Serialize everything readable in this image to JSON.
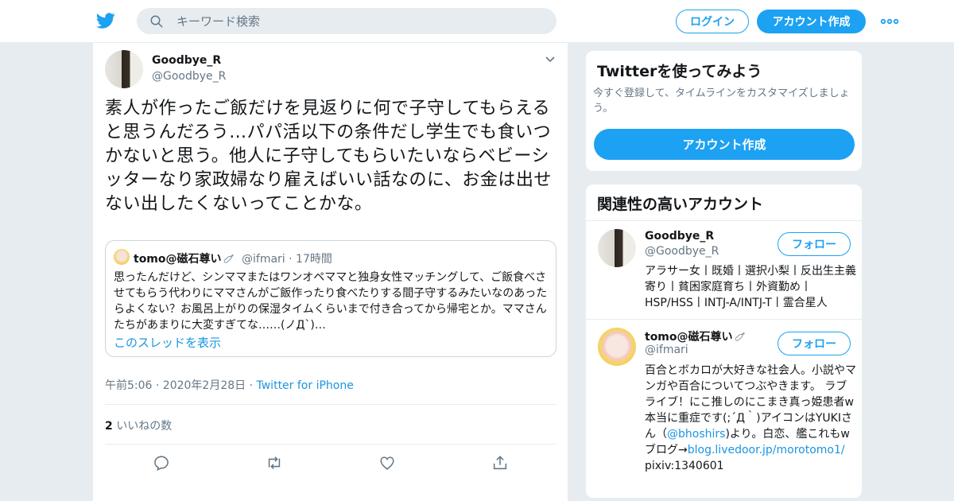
{
  "header": {
    "search_placeholder": "キーワード検索",
    "login_label": "ログイン",
    "signup_label": "アカウント作成"
  },
  "tweet": {
    "author_name": "Goodbye_R",
    "author_handle": "@Goodbye_R",
    "text": "素人が作ったご飯だけを見返りに何で子守してもらえると思うんだろう…パパ活以下の条件だし学生でも食いつかないと思う。他人に子守してもらいたいならベビーシッターなり家政婦なり雇えばいい話なのに、お金は出せない出したくないってことかな。",
    "quote": {
      "author_name": "tomo@磁石尊い",
      "author_handle": "@ifmari",
      "time_ago": "17時間",
      "text": "思ったんだけど、シンママまたはワンオペママと独身女性マッチングして、ご飯食べさせてもらう代わりにママさんがご飯作ったり食べたりする間子守するみたいなのあったらよくない？お風呂上がりの保湿タイムくらいまで付き合ってから帰宅とか。ママさんたちがあまりに大変すぎてな……(ノД`)…",
      "show_thread_label": "このスレッドを表示"
    },
    "timestamp": "午前5:06 · 2020年2月28日",
    "source": "Twitter for iPhone",
    "likes_count": "2",
    "likes_label": "いいねの数"
  },
  "sidebar": {
    "signup_card": {
      "title": "Twitterを使ってみよう",
      "description": "今すぐ登録して、タイムラインをカスタマイズしましょう。",
      "button_label": "アカウント作成"
    },
    "related": {
      "title": "関連性の高いアカウント",
      "follow_label": "フォロー",
      "accounts": [
        {
          "name": "Goodbye_R",
          "handle": "@Goodbye_R",
          "bio": "アラサー女丨既婚丨選択小梨丨反出生主義寄り丨貧困家庭育ち丨外資勤め丨HSP/HSS丨INTJ-A/INTJ-T丨霊合星人"
        },
        {
          "name": "tomo@磁石尊い",
          "handle": "@ifmari",
          "bio_part1": "百合とボカロが大好きな社会人。小説やマンガや百合についてつぶやきます。 ラブライブ！にこ推しのにこまき真っ姫患者w本当に重症です(;´Д｀)アイコンはYUKIさん（",
          "bio_mention": "@bhoshirs",
          "bio_part2": ")より。白恋、艦これもw ブログ→",
          "bio_link": "blog.livedoor.jp/morotomo1/",
          "bio_part3": "pixiv:1340601"
        }
      ]
    }
  },
  "colors": {
    "accent": "#1da1f2",
    "link": "#1b95e0",
    "secondary_text": "#657786",
    "background": "#e6ecf0"
  },
  "icons": [
    "twitter-bird-icon",
    "search-icon",
    "more-icon",
    "chevron-down-icon",
    "reply-icon",
    "retweet-icon",
    "like-icon",
    "share-icon",
    "pin-icon"
  ]
}
